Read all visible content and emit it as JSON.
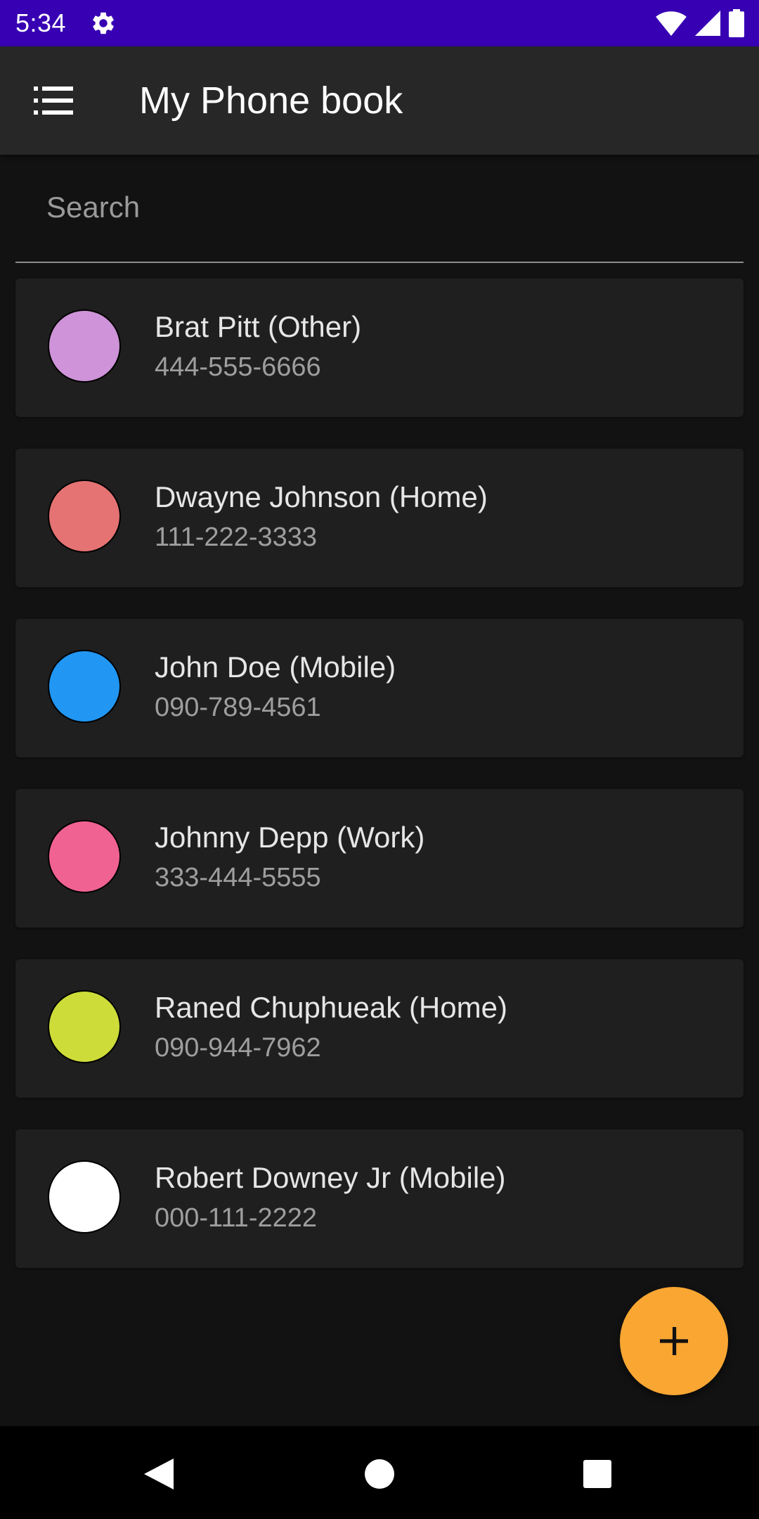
{
  "status_bar": {
    "time": "5:34",
    "background": "#3700b3",
    "icons": [
      "gear-icon",
      "wifi-icon",
      "signal-icon",
      "battery-icon"
    ]
  },
  "app_bar": {
    "title": "My Phone book",
    "menu_icon": "list-icon",
    "background": "#272727"
  },
  "search": {
    "placeholder": "Search",
    "value": ""
  },
  "contacts": [
    {
      "name": "Brat Pitt (Other)",
      "phone": "444-555-6666",
      "color": "#ce93d8"
    },
    {
      "name": "Dwayne Johnson (Home)",
      "phone": "111-222-3333",
      "color": "#e57373"
    },
    {
      "name": "John Doe (Mobile)",
      "phone": "090-789-4561",
      "color": "#2196f3"
    },
    {
      "name": "Johnny Depp (Work)",
      "phone": "333-444-5555",
      "color": "#f06292"
    },
    {
      "name": "Raned Chuphueak (Home)",
      "phone": "090-944-7962",
      "color": "#cddc39"
    },
    {
      "name": "Robert Downey Jr (Mobile)",
      "phone": "000-111-2222",
      "color": "#ffffff"
    }
  ],
  "fab": {
    "icon": "plus-icon",
    "color": "#f9a633"
  },
  "nav_bar": {
    "icons": [
      "back-icon",
      "home-icon",
      "recents-icon"
    ]
  }
}
